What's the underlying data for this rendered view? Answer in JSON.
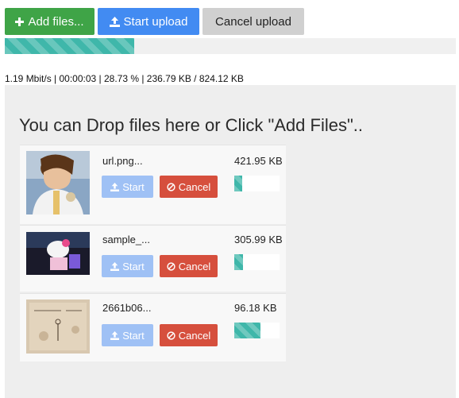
{
  "toolbar": {
    "add_label": "Add files...",
    "start_label": "Start upload",
    "cancel_label": "Cancel upload"
  },
  "global_progress": {
    "percent": 28.73
  },
  "status": "1.19 Mbit/s | 00:00:03 | 28.73 % | 236.79 KB / 824.12 KB",
  "dropzone": {
    "hint": "You can Drop files here or Click \"Add Files\".."
  },
  "files": [
    {
      "name": "url.png...",
      "size": "421.95 KB",
      "progress": 0.18,
      "start_label": "Start",
      "cancel_label": "Cancel"
    },
    {
      "name": "sample_...",
      "size": "305.99 KB",
      "progress": 0.2,
      "start_label": "Start",
      "cancel_label": "Cancel"
    },
    {
      "name": "2661b06...",
      "size": "96.18 KB",
      "progress": 0.58,
      "start_label": "Start",
      "cancel_label": "Cancel"
    }
  ],
  "colors": {
    "accent_green": "#3fa447",
    "accent_blue": "#428bf2",
    "danger": "#d64f3d",
    "progress": "#3fb7aa"
  }
}
